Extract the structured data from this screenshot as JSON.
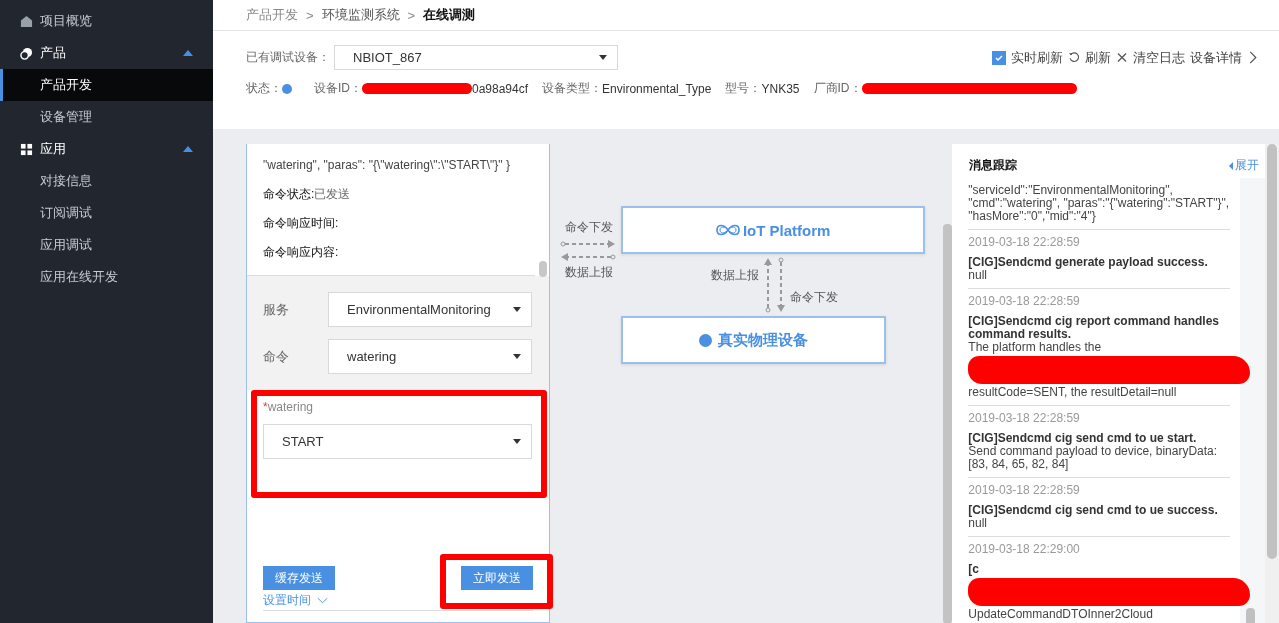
{
  "sidebar": {
    "items": [
      {
        "label": "项目概览",
        "selected": false
      },
      {
        "label": "产品",
        "expanded": true,
        "selected": false,
        "children": [
          {
            "label": "产品开发",
            "selected": true
          },
          {
            "label": "设备管理",
            "selected": false
          }
        ]
      },
      {
        "label": "应用",
        "expanded": true,
        "selected": false,
        "children": [
          {
            "label": "对接信息",
            "selected": false
          },
          {
            "label": "订阅调试",
            "selected": false
          },
          {
            "label": "应用调试",
            "selected": false
          },
          {
            "label": "应用在线开发",
            "selected": false
          }
        ]
      }
    ]
  },
  "breadcrumb": [
    "产品开发",
    "环境监测系统",
    "在线调测"
  ],
  "breadcrumb_separator": ">",
  "device": {
    "label": "已有调试设备：",
    "value": "NBIOT_867",
    "status_label": "状态：",
    "fields": [
      {
        "label": "设备ID：",
        "value": "0a98a94cf",
        "redacted": true
      },
      {
        "label": "设备类型：",
        "value": "Environmental_Type"
      },
      {
        "label": "型号：",
        "value": "YNK35"
      },
      {
        "label": "厂商ID：",
        "redacted": true
      }
    ]
  },
  "toolbar": {
    "realtime": {
      "label": "实时刷新",
      "checked": true
    },
    "refresh": "刷新",
    "clear": "清空日志",
    "details": "设备详情"
  },
  "command": {
    "payload": "\"watering\", \"paras\": \"{\\\"watering\\\":\\\"START\\\"}\" }",
    "status": [
      {
        "label": "命令状态:",
        "value": "已发送"
      },
      {
        "label": "命令响应时间:"
      },
      {
        "label": "命令响应内容:"
      }
    ],
    "form": [
      {
        "label": "服务",
        "value": "EnvironmentalMonitoring"
      },
      {
        "label": "命令",
        "value": "watering"
      }
    ],
    "param": {
      "mark": "*",
      "label": "watering",
      "value": "START"
    },
    "buttons": [
      "缓存发送",
      "立即发送"
    ],
    "schedule": "设置时间"
  },
  "diagram": {
    "down_left": "命令下发",
    "up_left": "数据上报",
    "platform": "IoT Platform",
    "up_right": "数据上报",
    "down_right": "命令下发",
    "device": "真实物理设备"
  },
  "log": {
    "title": "消息跟踪",
    "expand": "展开",
    "entries": [
      {
        "body": "\"serviceId\":\"EnvironmentalMonitoring\", \"cmd\":\"watering\", \"paras\":\"{\"watering\":\"START\"}\", \"hasMore\":\"0\",\"mid\":\"4\"}"
      },
      {
        "time": "2019-03-18 22:28:59",
        "title": "[CIG]Sendcmd generate payload success.",
        "body": "null"
      },
      {
        "time": "2019-03-18 22:28:59",
        "title": "[CIG]Sendcmd cig report command handles command results.",
        "body": "The platform handles the",
        "redacted": true,
        "after": "resultCode=SENT, the resultDetail=null"
      },
      {
        "time": "2019-03-18 22:28:59",
        "title": "[CIG]Sendcmd cig send cmd to ue start.",
        "body": "Send command payload to device, binaryData: [83, 84, 65, 82, 84]"
      },
      {
        "time": "2019-03-18 22:28:59",
        "title": "[CIG]Sendcmd cig send cmd to ue success.",
        "body": "null"
      },
      {
        "time": "2019-03-18 22:29:00",
        "title": "[c",
        "redacted": true,
        "after": "UpdateCommandDTOInner2Cloud"
      }
    ]
  }
}
